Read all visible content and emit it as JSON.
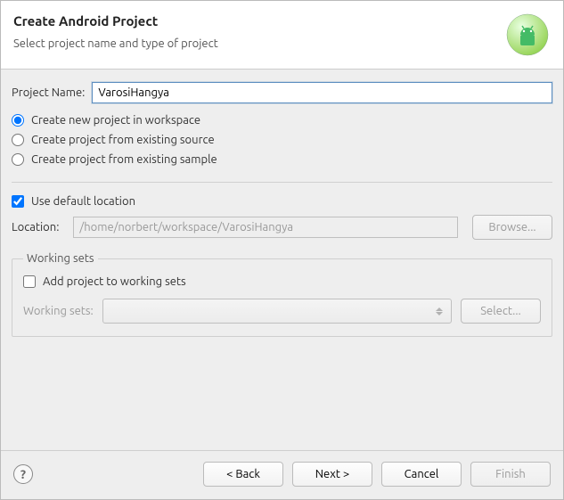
{
  "header": {
    "title": "Create Android Project",
    "subtitle": "Select project name and type of project"
  },
  "project_name": {
    "label": "Project Name:",
    "value": "VarosiHangya"
  },
  "source_options": {
    "new_workspace": "Create new project in workspace",
    "existing_source": "Create project from existing source",
    "existing_sample": "Create project from existing sample",
    "selected": "new_workspace"
  },
  "default_location": {
    "label": "Use default location",
    "checked": true
  },
  "location": {
    "label": "Location:",
    "value": "/home/norbert/workspace/VarosiHangya",
    "browse": "Browse..."
  },
  "working_sets": {
    "legend": "Working sets",
    "add_label": "Add project to working sets",
    "add_checked": false,
    "select_label": "Working sets:",
    "select_button": "Select..."
  },
  "footer": {
    "back": "< Back",
    "next": "Next >",
    "cancel": "Cancel",
    "finish": "Finish"
  }
}
